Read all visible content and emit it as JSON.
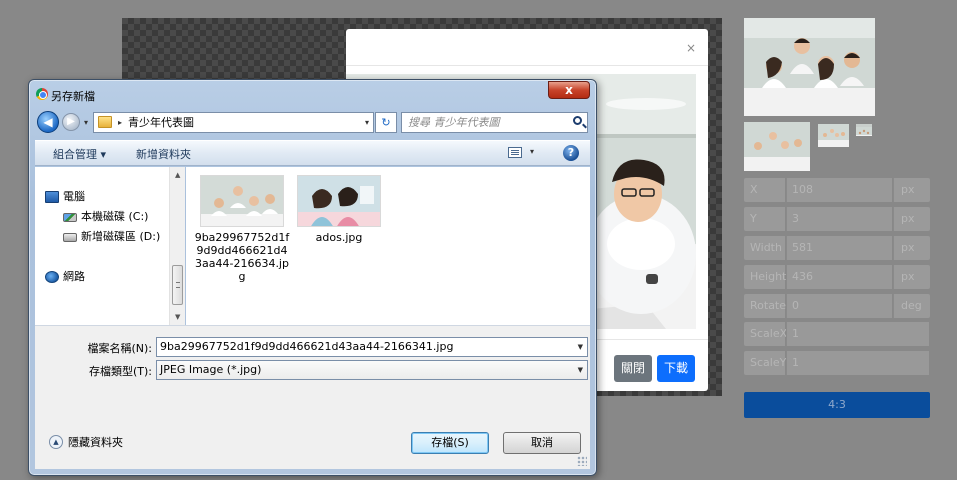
{
  "modal": {
    "close_glyph": "×",
    "close_label": "關閉",
    "download_label": "下載"
  },
  "sidebar": {
    "fields": [
      {
        "label": "X",
        "value": "108",
        "unit": "px"
      },
      {
        "label": "Y",
        "value": "3",
        "unit": "px"
      },
      {
        "label": "Width",
        "value": "581",
        "unit": "px"
      },
      {
        "label": "Height",
        "value": "436",
        "unit": "px"
      },
      {
        "label": "Rotate",
        "value": "0",
        "unit": "deg"
      },
      {
        "label": "ScaleX",
        "value": "1",
        "unit": ""
      },
      {
        "label": "ScaleY",
        "value": "1",
        "unit": ""
      }
    ],
    "aspect_ratio_label": "4:3"
  },
  "dialog": {
    "title": "另存新檔",
    "close_glyph": "x",
    "address": {
      "separator": "▸",
      "folder_name": "青少年代表圖",
      "dropdown_glyph": "▾"
    },
    "refresh_glyph": "↻",
    "search_placeholder": "搜尋 青少年代表圖",
    "toolbar": {
      "organize_label": "組合管理 ▾",
      "new_folder_label": "新增資料夾",
      "view_dropdown_glyph": "▾",
      "help_glyph": "?"
    },
    "nav_tree": [
      {
        "label": "電腦",
        "icon": "computer-icon"
      },
      {
        "label": "本機磁碟 (C:)",
        "icon": "drive-c-icon"
      },
      {
        "label": "新增磁碟區 (D:)",
        "icon": "drive-d-icon"
      },
      {
        "label": "網路",
        "icon": "network-icon"
      }
    ],
    "files": [
      {
        "name": "9ba29967752d1f9d9dd466621d43aa44-216634.jpg"
      },
      {
        "name": "ados.jpg"
      }
    ],
    "filename_label": "檔案名稱(N):",
    "filename_value": "9ba29967752d1f9d9dd466621d43aa44-2166341.jpg",
    "filetype_label": "存檔類型(T):",
    "filetype_value": "JPEG Image (*.jpg)",
    "hide_folders_label": "隱藏資料夾",
    "save_label": "存檔(S)",
    "cancel_label": "取消"
  },
  "colors": {
    "primary_button": "#0d6efd",
    "secondary_button": "#6c757d",
    "ratio_button": "#0a4d9c",
    "page_background": "#888888"
  }
}
